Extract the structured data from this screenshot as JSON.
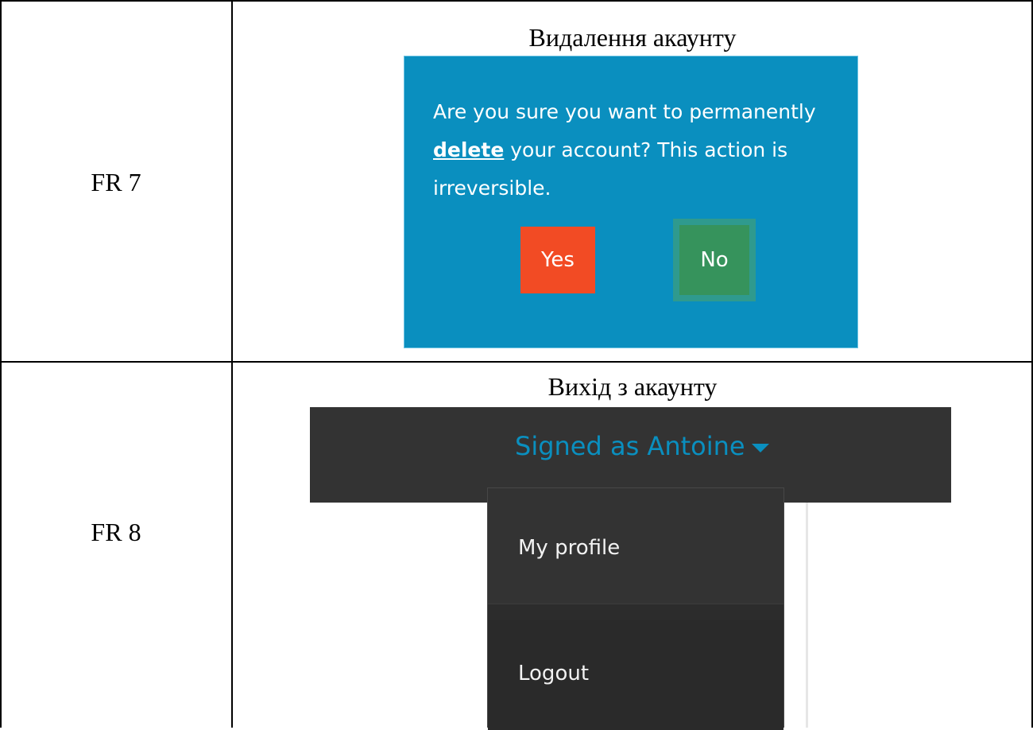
{
  "rows": [
    {
      "id": "FR 7",
      "caption": "Видалення акаунту",
      "dialog": {
        "text_before": "Are you sure you want to permanently ",
        "text_emphasis": "delete",
        "text_after": " your account? This action is irreversible.",
        "yes_label": "Yes",
        "no_label": "No"
      }
    },
    {
      "id": "FR 8",
      "caption": "Вихід з акаунту",
      "menu": {
        "toggle_label": "Signed as Antoine",
        "items": [
          {
            "label": "My profile"
          },
          {
            "label": "Logout"
          }
        ]
      }
    }
  ],
  "colors": {
    "dialog_bg": "#0a8fbf",
    "yes_button": "#f24b24",
    "no_button": "#36935c",
    "navbar_bg": "#333333",
    "toggle_text": "#0a8fbf"
  },
  "icons": {
    "toggle_caret": "caret-down-icon"
  }
}
